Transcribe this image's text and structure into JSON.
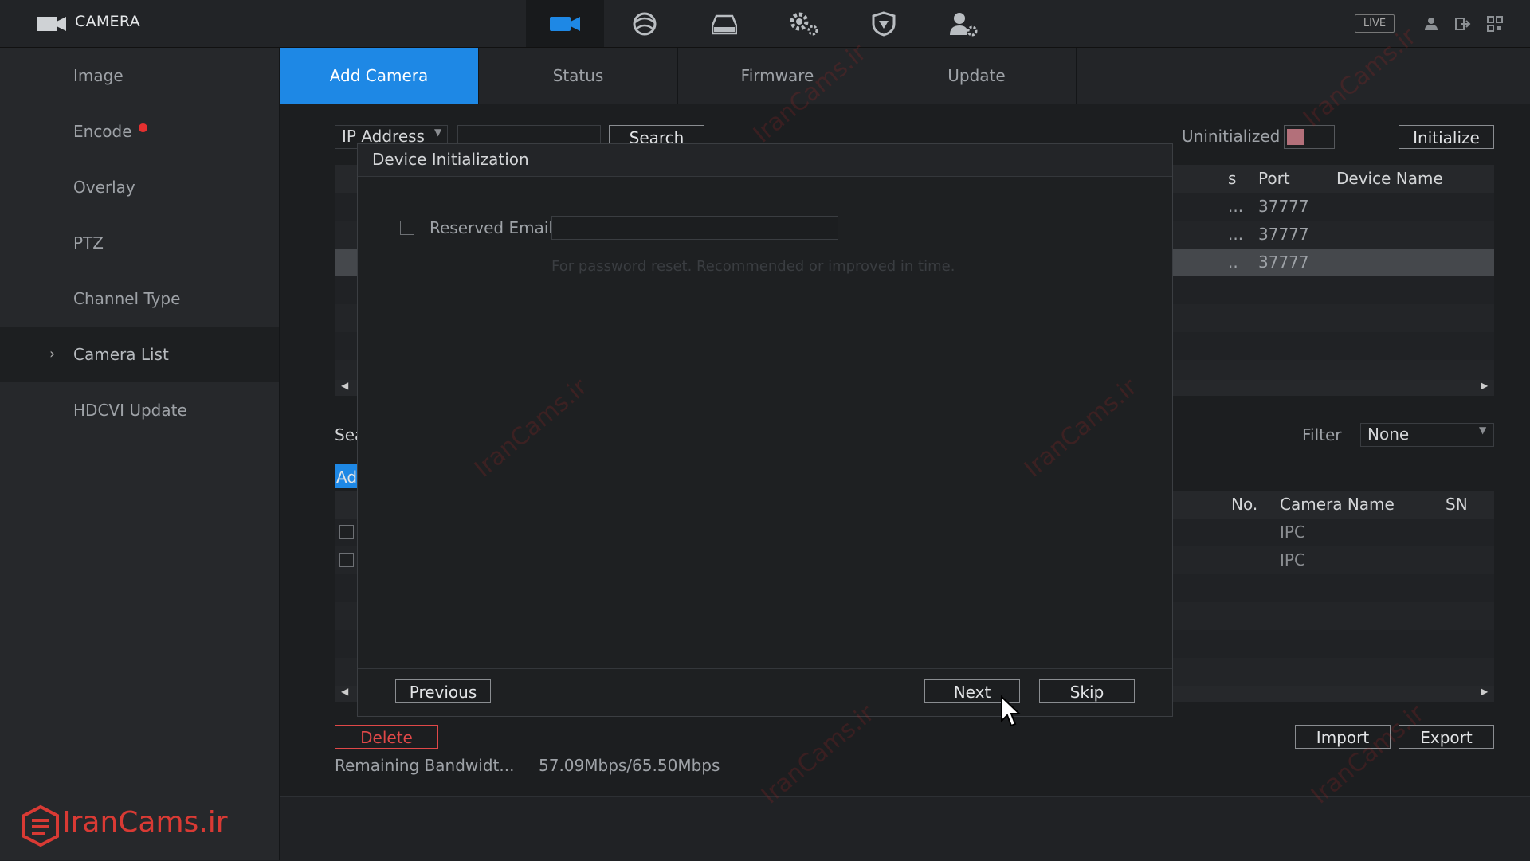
{
  "app": {
    "title": "CAMERA",
    "live_badge": "LIVE"
  },
  "top_icons": [
    "camera-icon",
    "network-icon",
    "storage-icon",
    "settings-icon",
    "security-icon",
    "account-icon"
  ],
  "sidebar": {
    "items": [
      {
        "label": "Image"
      },
      {
        "label": "Encode"
      },
      {
        "label": "Overlay"
      },
      {
        "label": "PTZ"
      },
      {
        "label": "Channel Type"
      },
      {
        "label": "Camera List",
        "active": true
      },
      {
        "label": "HDCVI Update"
      }
    ]
  },
  "tabs": [
    {
      "label": "Add Camera",
      "active": true
    },
    {
      "label": "Status"
    },
    {
      "label": "Firmware"
    },
    {
      "label": "Update"
    }
  ],
  "search_bar": {
    "select_value": "IP Address",
    "search_label": "Search",
    "uninitialized_label": "Uninitialized",
    "initialize_label": "Initialize"
  },
  "device_table": {
    "columns_visible": [
      "s",
      "Port",
      "Device Name"
    ],
    "rows": [
      {
        "trunc": "...",
        "port": "37777",
        "name": ""
      },
      {
        "trunc": "...",
        "port": "37777",
        "name": ""
      },
      {
        "trunc": "..",
        "port": "37777",
        "name": ""
      }
    ]
  },
  "added_section": {
    "search_label_partial": "Sea",
    "add_label_partial": "Ad",
    "filter_label": "Filter",
    "filter_value": "None",
    "columns_visible": [
      "No.",
      "Camera Name",
      "SN"
    ],
    "rows": [
      {
        "camera_name": "IPC"
      },
      {
        "camera_name": "IPC"
      }
    ]
  },
  "bottom": {
    "delete_label": "Delete",
    "import_label": "Import",
    "export_label": "Export",
    "bandwidth_label": "Remaining Bandwidt...",
    "bandwidth_value": "57.09Mbps/65.50Mbps"
  },
  "modal": {
    "title": "Device Initialization",
    "reserved_email_label": "Reserved Email",
    "reserved_email_value": "",
    "hint": "For password reset. Recommended or improved in time.",
    "previous_label": "Previous",
    "next_label": "Next",
    "skip_label": "Skip"
  },
  "watermark": {
    "logo_text": "IranCams.ir",
    "text": "IranCams.ir"
  },
  "colors": {
    "accent": "#1e88e5",
    "danger": "#e53030",
    "logo": "#d93a34"
  }
}
